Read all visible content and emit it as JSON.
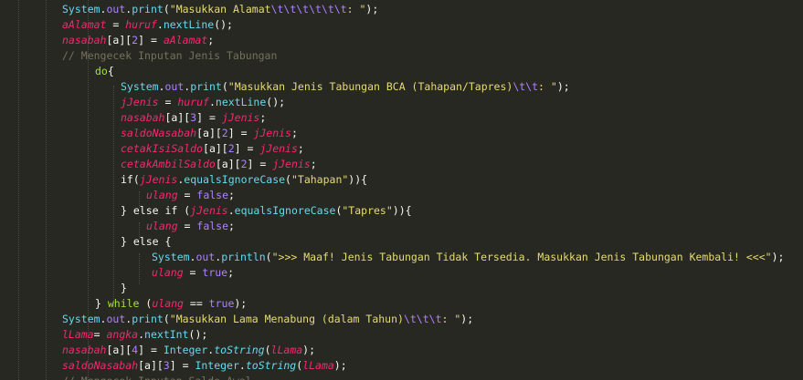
{
  "editor": {
    "lines": [
      {
        "indent": 68,
        "tokens": [
          [
            "class",
            "System"
          ],
          [
            "pl",
            "."
          ],
          [
            "field",
            "out"
          ],
          [
            "pl",
            "."
          ],
          [
            "method",
            "print"
          ],
          [
            "pl",
            "("
          ],
          [
            "str",
            "\"Masukkan Alamat"
          ],
          [
            "esc",
            "\\t\\t\\t\\t\\t\\t"
          ],
          [
            "str",
            ": \""
          ],
          [
            "pl",
            ");"
          ]
        ]
      },
      {
        "indent": 68,
        "tokens": [
          [
            "var",
            "aAlamat"
          ],
          [
            "pl",
            " = "
          ],
          [
            "var",
            "huruf"
          ],
          [
            "pl",
            "."
          ],
          [
            "method",
            "nextLine"
          ],
          [
            "pl",
            "();"
          ]
        ]
      },
      {
        "indent": 68,
        "tokens": [
          [
            "var",
            "nasabah"
          ],
          [
            "pl",
            "[a]["
          ],
          [
            "num",
            "2"
          ],
          [
            "pl",
            "] = "
          ],
          [
            "var",
            "aAlamat"
          ],
          [
            "pl",
            ";"
          ]
        ]
      },
      {
        "indent": 68,
        "tokens": [
          [
            "cm",
            "// Mengecek Inputan Jenis Tabungan"
          ]
        ]
      },
      {
        "indent": 104,
        "tokens": [
          [
            "kw2",
            "do"
          ],
          [
            "pl",
            "{"
          ]
        ]
      },
      {
        "indent": 132,
        "tokens": [
          [
            "class",
            "System"
          ],
          [
            "pl",
            "."
          ],
          [
            "field",
            "out"
          ],
          [
            "pl",
            "."
          ],
          [
            "method",
            "print"
          ],
          [
            "pl",
            "("
          ],
          [
            "str",
            "\"Masukkan Jenis Tabungan BCA (Tahapan/Tapres)"
          ],
          [
            "esc",
            "\\t\\t"
          ],
          [
            "str",
            ": \""
          ],
          [
            "pl",
            ");"
          ]
        ]
      },
      {
        "indent": 132,
        "tokens": [
          [
            "var",
            "jJenis"
          ],
          [
            "pl",
            " = "
          ],
          [
            "var",
            "huruf"
          ],
          [
            "pl",
            "."
          ],
          [
            "method",
            "nextLine"
          ],
          [
            "pl",
            "();"
          ]
        ]
      },
      {
        "indent": 132,
        "tokens": [
          [
            "var",
            "nasabah"
          ],
          [
            "pl",
            "[a]["
          ],
          [
            "num",
            "3"
          ],
          [
            "pl",
            "] = "
          ],
          [
            "var",
            "jJenis"
          ],
          [
            "pl",
            ";"
          ]
        ]
      },
      {
        "indent": 132,
        "tokens": [
          [
            "var",
            "saldoNasabah"
          ],
          [
            "pl",
            "[a]["
          ],
          [
            "num",
            "2"
          ],
          [
            "pl",
            "] = "
          ],
          [
            "var",
            "jJenis"
          ],
          [
            "pl",
            ";"
          ]
        ]
      },
      {
        "indent": 132,
        "tokens": [
          [
            "var",
            "cetakIsiSaldo"
          ],
          [
            "pl",
            "[a]["
          ],
          [
            "num",
            "2"
          ],
          [
            "pl",
            "] = "
          ],
          [
            "var",
            "jJenis"
          ],
          [
            "pl",
            ";"
          ]
        ]
      },
      {
        "indent": 132,
        "tokens": [
          [
            "var",
            "cetakAmbilSaldo"
          ],
          [
            "pl",
            "[a]["
          ],
          [
            "num",
            "2"
          ],
          [
            "pl",
            "] = "
          ],
          [
            "var",
            "jJenis"
          ],
          [
            "pl",
            ";"
          ]
        ]
      },
      {
        "indent": 132,
        "tokens": [
          [
            "pl",
            "if("
          ],
          [
            "var",
            "jJenis"
          ],
          [
            "pl",
            "."
          ],
          [
            "method",
            "equalsIgnoreCase"
          ],
          [
            "pl",
            "("
          ],
          [
            "str",
            "\"Tahapan\""
          ],
          [
            "pl",
            ")){"
          ]
        ]
      },
      {
        "indent": 160,
        "tokens": [
          [
            "var",
            "ulang"
          ],
          [
            "pl",
            " = "
          ],
          [
            "bool",
            "false"
          ],
          [
            "pl",
            ";"
          ]
        ]
      },
      {
        "indent": 132,
        "tokens": [
          [
            "pl",
            "} else if ("
          ],
          [
            "var",
            "jJenis"
          ],
          [
            "pl",
            "."
          ],
          [
            "method",
            "equalsIgnoreCase"
          ],
          [
            "pl",
            "("
          ],
          [
            "str",
            "\"Tapres\""
          ],
          [
            "pl",
            ")){"
          ]
        ]
      },
      {
        "indent": 160,
        "tokens": [
          [
            "var",
            "ulang"
          ],
          [
            "pl",
            " = "
          ],
          [
            "bool",
            "false"
          ],
          [
            "pl",
            ";"
          ]
        ]
      },
      {
        "indent": 132,
        "tokens": [
          [
            "pl",
            "} else {"
          ]
        ]
      },
      {
        "indent": 166,
        "tokens": [
          [
            "class",
            "System"
          ],
          [
            "pl",
            "."
          ],
          [
            "field",
            "out"
          ],
          [
            "pl",
            "."
          ],
          [
            "method",
            "println"
          ],
          [
            "pl",
            "("
          ],
          [
            "str",
            "\">>> Maaf! Jenis Tabungan Tidak Tersedia. Masukkan Jenis Tabungan Kembali! <<<\""
          ],
          [
            "pl",
            ");"
          ]
        ]
      },
      {
        "indent": 166,
        "tokens": [
          [
            "var",
            "ulang"
          ],
          [
            "pl",
            " = "
          ],
          [
            "bool",
            "true"
          ],
          [
            "pl",
            ";"
          ]
        ]
      },
      {
        "indent": 132,
        "tokens": [
          [
            "pl",
            "}"
          ]
        ]
      },
      {
        "indent": 104,
        "tokens": [
          [
            "pl",
            "} "
          ],
          [
            "kw2",
            "while"
          ],
          [
            "pl",
            " ("
          ],
          [
            "var",
            "ulang"
          ],
          [
            "pl",
            " == "
          ],
          [
            "bool",
            "true"
          ],
          [
            "pl",
            ");"
          ]
        ]
      },
      {
        "indent": 68,
        "tokens": [
          [
            "class",
            "System"
          ],
          [
            "pl",
            "."
          ],
          [
            "field",
            "out"
          ],
          [
            "pl",
            "."
          ],
          [
            "method",
            "print"
          ],
          [
            "pl",
            "("
          ],
          [
            "str",
            "\"Masukkan Lama Menabung (dalam Tahun)"
          ],
          [
            "esc",
            "\\t\\t\\t"
          ],
          [
            "str",
            ": \""
          ],
          [
            "pl",
            ");"
          ]
        ]
      },
      {
        "indent": 68,
        "tokens": [
          [
            "var",
            "lLama"
          ],
          [
            "pl",
            "= "
          ],
          [
            "var",
            "angka"
          ],
          [
            "pl",
            "."
          ],
          [
            "method",
            "nextInt"
          ],
          [
            "pl",
            "();"
          ]
        ]
      },
      {
        "indent": 68,
        "tokens": [
          [
            "var",
            "nasabah"
          ],
          [
            "pl",
            "[a]["
          ],
          [
            "num",
            "4"
          ],
          [
            "pl",
            "] = "
          ],
          [
            "class",
            "Integer"
          ],
          [
            "pl",
            "."
          ],
          [
            "sm",
            "toString"
          ],
          [
            "pl",
            "("
          ],
          [
            "var",
            "lLama"
          ],
          [
            "pl",
            ");"
          ]
        ]
      },
      {
        "indent": 68,
        "tokens": [
          [
            "var",
            "saldoNasabah"
          ],
          [
            "pl",
            "[a]["
          ],
          [
            "num",
            "3"
          ],
          [
            "pl",
            "] = "
          ],
          [
            "class",
            "Integer"
          ],
          [
            "pl",
            "."
          ],
          [
            "sm",
            "toString"
          ],
          [
            "pl",
            "("
          ],
          [
            "var",
            "lLama"
          ],
          [
            "pl",
            ");"
          ]
        ]
      },
      {
        "indent": 68,
        "tokens": [
          [
            "cm",
            "// Mengecek Inputan Saldo Awal"
          ]
        ]
      }
    ]
  }
}
